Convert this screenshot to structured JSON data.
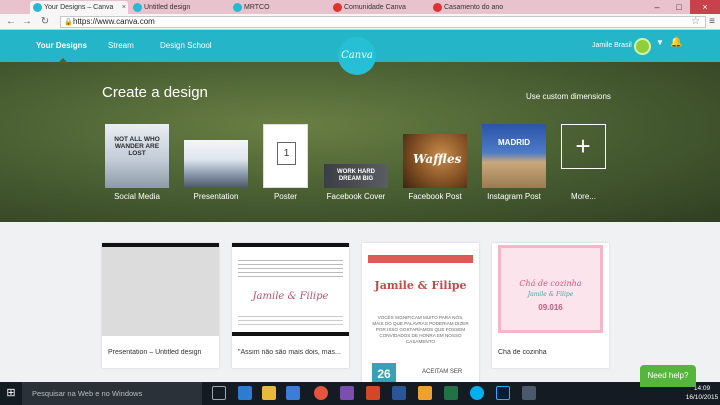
{
  "browser": {
    "tabs": [
      {
        "title": "Your Designs – Canva",
        "active": true
      },
      {
        "title": "Untitled design",
        "active": false
      },
      {
        "title": "MRTCO",
        "active": false
      },
      {
        "title": "Comunidade Canva",
        "active": false
      },
      {
        "title": "Casamento do ano",
        "active": false
      }
    ],
    "url": "https://www.canva.com"
  },
  "nav": {
    "links": [
      "Your Designs",
      "Stream",
      "Design School"
    ],
    "logo": "Canva",
    "user_name": "Jamile Brasil"
  },
  "hero": {
    "title": "Create a design",
    "custom_dimensions": "Use custom dimensions",
    "templates": [
      {
        "label": "Social Media",
        "thumb_text": "NOT ALL WHO WANDER ARE LOST"
      },
      {
        "label": "Presentation",
        "thumb_text": ""
      },
      {
        "label": "Poster",
        "thumb_text": "1"
      },
      {
        "label": "Facebook Cover",
        "thumb_text": "WORK HARD DREAM BIG"
      },
      {
        "label": "Facebook Post",
        "thumb_text": "Waffles"
      },
      {
        "label": "Instagram Post",
        "thumb_text": "MADRID"
      },
      {
        "label": "More...",
        "thumb_text": "+"
      }
    ]
  },
  "designs": [
    {
      "caption": "Presentation – Untitled design"
    },
    {
      "caption": "\"Assim não são mais dois, mas..."
    },
    {
      "caption": "",
      "heading": "Jamile & Filipe",
      "body": "VOCÊS SIGNIFICAM MUITO PARA NÓS, MAIS DO QUE PALAVRAS PODERIAM DIZER POR ISSO GOSTARÍAMOS QUE FOSSEM CONVIDADOS DE HONRA EM NOSSO CASAMENTO",
      "date": "26",
      "bottom": "ACEITAM SER"
    },
    {
      "caption": "Chá de cozinha",
      "heading": "Chá de cozinha",
      "names": "Jamile & Filipe",
      "date": "09.016"
    }
  ],
  "help": "Need help?",
  "taskbar": {
    "search_placeholder": "Pesquisar na Web e no Windows",
    "time": "14:09",
    "date": "16/10/2015"
  }
}
